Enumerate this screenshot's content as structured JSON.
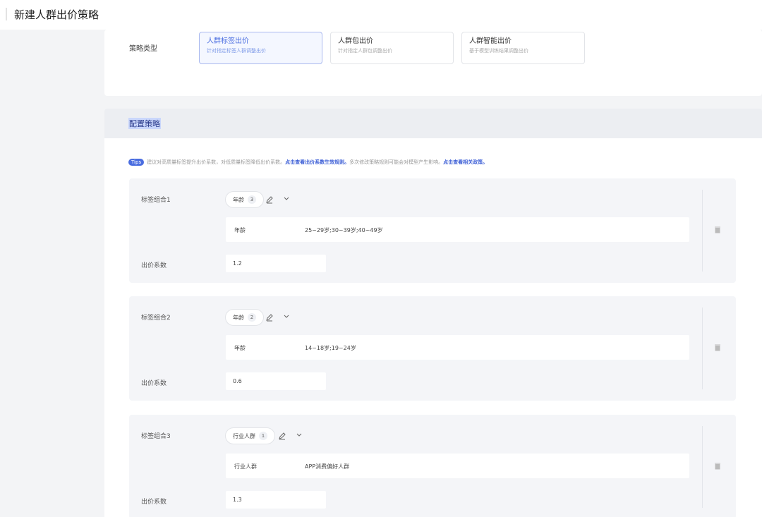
{
  "header": {
    "title": "新建人群出价策略"
  },
  "strategy_type": {
    "label": "策略类型",
    "options": [
      {
        "title": "人群标签出价",
        "desc": "针对指定标签人群调整出价",
        "active": true
      },
      {
        "title": "人群包出价",
        "desc": "针对指定人群包调整出价",
        "active": false
      },
      {
        "title": "人群智能出价",
        "desc": "基于模型训练结果调整出价",
        "active": false
      }
    ]
  },
  "config": {
    "title": "配置策略",
    "tips": {
      "badge": "Tips",
      "text1": "建议对高质量标签提升出价系数，对低质量标签降低出价系数。",
      "link1": "点击查看出价系数生效规则。",
      "text2": "多次修改策略规则可能会对模型产生影响。",
      "link2": "点击查看相关政策。"
    },
    "groups": [
      {
        "label": "标签组合1",
        "chip": "年龄",
        "count": "3",
        "detail_key": "年龄",
        "detail_value": "25~29岁;30~39岁;40~49岁",
        "coef_label": "出价系数",
        "coef_value": "1.2"
      },
      {
        "label": "标签组合2",
        "chip": "年龄",
        "count": "2",
        "detail_key": "年龄",
        "detail_value": "14~18岁;19~24岁",
        "coef_label": "出价系数",
        "coef_value": "0.6"
      },
      {
        "label": "标签组合3",
        "chip": "行业人群",
        "count": "1",
        "detail_key": "行业人群",
        "detail_value": "APP消费偏好人群",
        "coef_label": "出价系数",
        "coef_value": "1.3"
      }
    ]
  },
  "icons": {
    "edit": "edit-pencil-icon",
    "chevron": "chevron-down-icon",
    "trash": "trash-icon"
  },
  "colors": {
    "accent": "#4a6de0",
    "link": "#3d5fd6"
  }
}
